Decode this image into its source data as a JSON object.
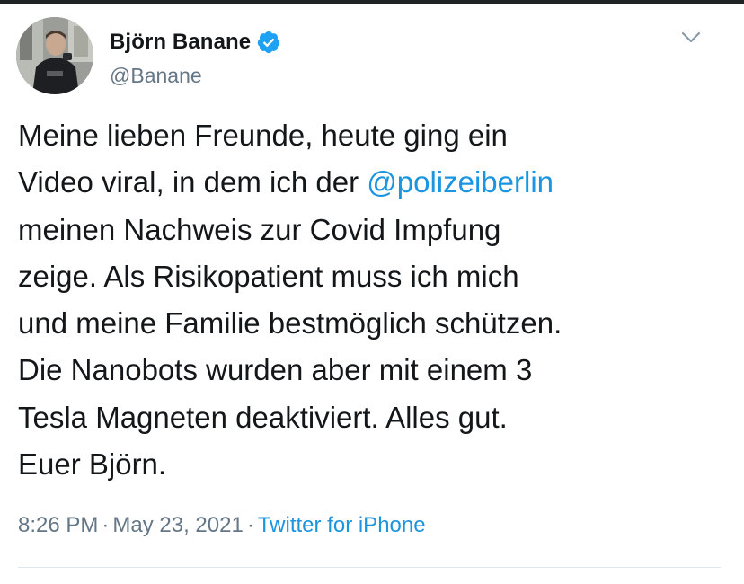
{
  "user": {
    "display_name": "Björn Banane",
    "handle": "@Banane",
    "verified": true
  },
  "tweet": {
    "lines": [
      {
        "text": "Meine lieben Freunde, heute ging ein"
      },
      {
        "pre": "Video viral, in dem ich der ",
        "mention": "@polizeiberlin"
      },
      {
        "text": "meinen Nachweis zur Covid Impfung"
      },
      {
        "text": "zeige. Als Risikopatient muss ich mich"
      },
      {
        "text": "und meine Familie bestmöglich schützen."
      },
      {
        "text": "Die Nanobots wurden aber mit einem 3"
      },
      {
        "text": "Tesla Magneten deaktiviert. Alles gut."
      },
      {
        "text": "Euer Björn."
      }
    ]
  },
  "meta": {
    "time": "8:26 PM",
    "separator": "·",
    "date": "May 23, 2021",
    "source": "Twitter for iPhone"
  },
  "icons": {
    "verified": "verified-badge-icon",
    "caret": "chevron-down-icon"
  },
  "colors": {
    "link": "#1b95e0",
    "secondary_text": "#657786",
    "primary_text": "#14171a",
    "verified": "#1da1f2"
  }
}
